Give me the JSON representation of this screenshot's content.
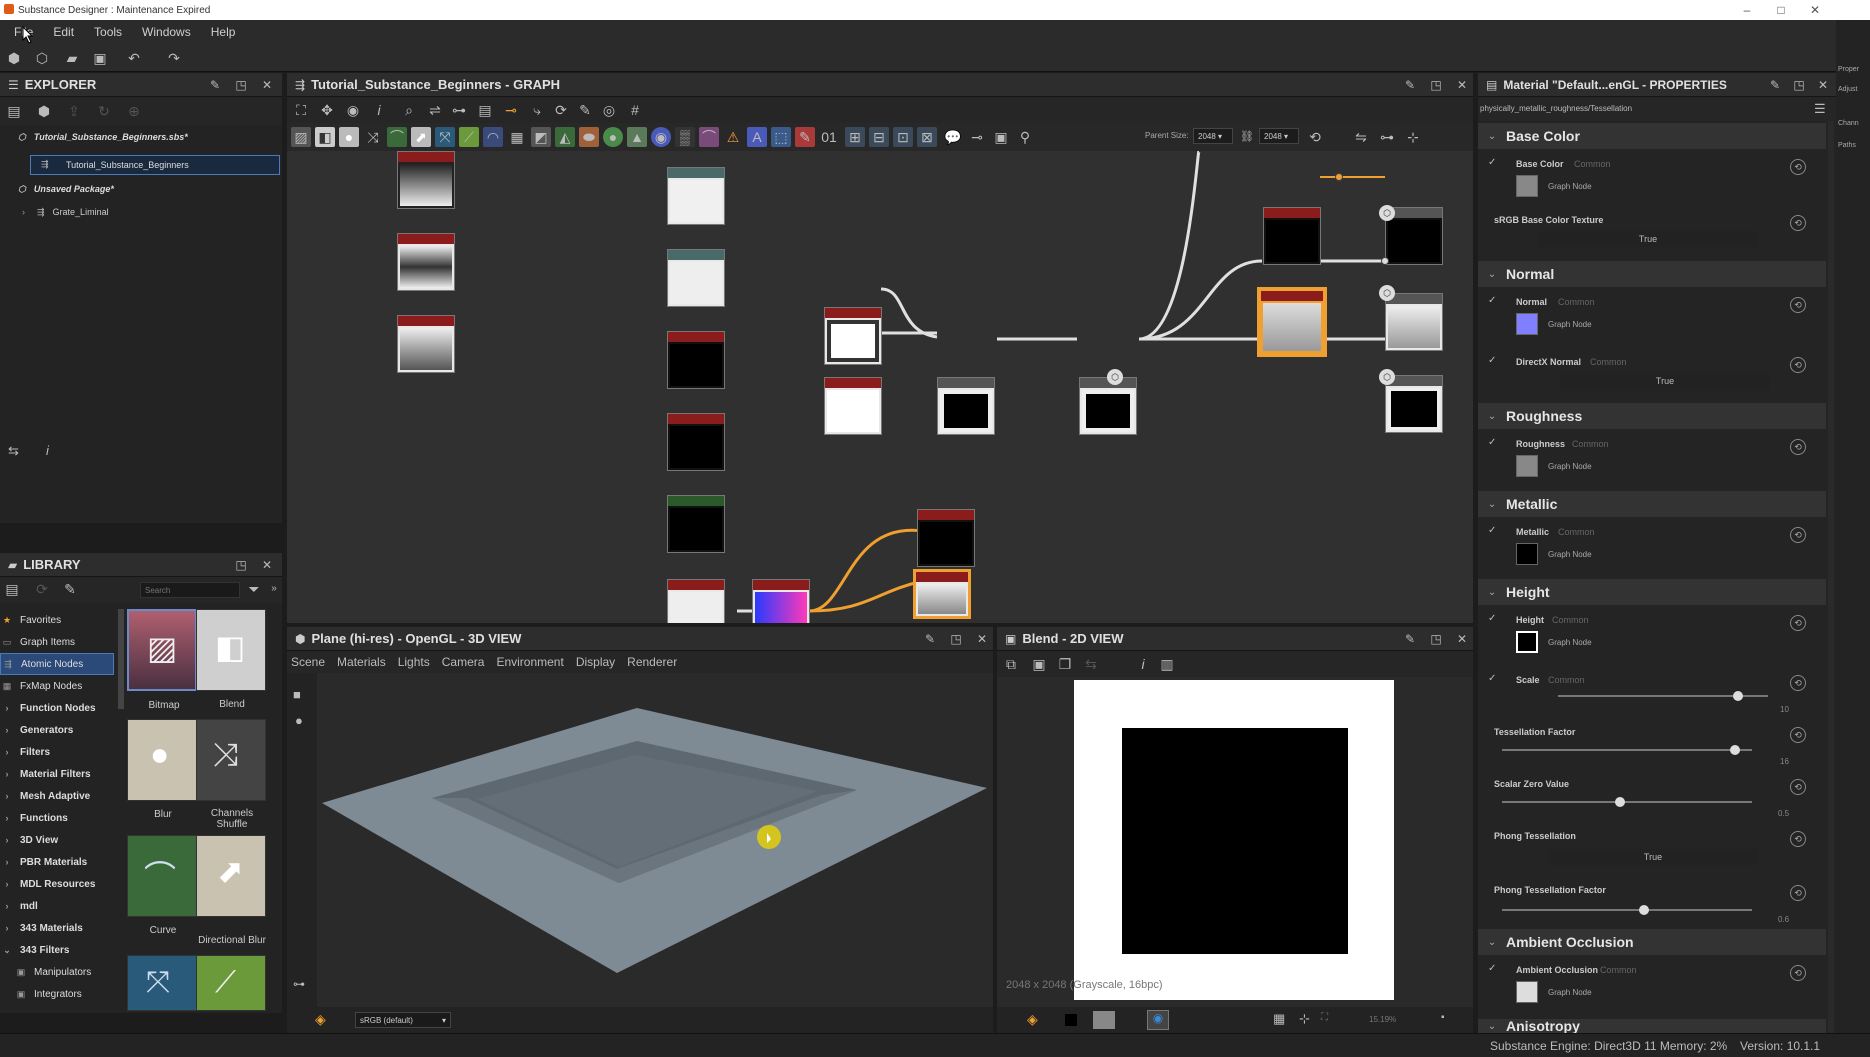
{
  "window": {
    "title": "Substance Designer : Maintenance Expired",
    "minimize": "–",
    "maximize": "□",
    "close": "✕"
  },
  "menu": [
    "File",
    "Edit",
    "Tools",
    "Windows",
    "Help"
  ],
  "explorer": {
    "title": "EXPLORER",
    "items": [
      {
        "label": "Tutorial_Substance_Beginners.sbs*"
      },
      {
        "label": "Tutorial_Substance_Beginners"
      },
      {
        "label": "Unsaved Package*"
      },
      {
        "label": "Grate_Liminal"
      }
    ]
  },
  "library": {
    "title": "LIBRARY",
    "search_placeholder": "Search",
    "categories": [
      "Favorites",
      "Graph Items",
      "Atomic Nodes",
      "FxMap Nodes",
      "Function Nodes",
      "Generators",
      "Filters",
      "Material Filters",
      "Mesh Adaptive",
      "Functions",
      "3D View",
      "PBR Materials",
      "MDL Resources",
      "mdl",
      "343 Materials",
      "343 Filters",
      "Manipulators",
      "Integrators"
    ],
    "thumbs": [
      "Bitmap",
      "Blend",
      "Blur",
      "Channels Shuffle",
      "Curve",
      "Directional Blur"
    ]
  },
  "graph": {
    "title": "Tutorial_Substance_Beginners - GRAPH",
    "parent_size_label": "Parent Size:",
    "parent_size_value": "2048",
    "size_value": "2048"
  },
  "view3d": {
    "title": "Plane (hi-res) - OpenGL - 3D VIEW",
    "menu": [
      "Scene",
      "Materials",
      "Lights",
      "Camera",
      "Environment",
      "Display",
      "Renderer"
    ],
    "colorspace": "sRGB (default)"
  },
  "view2d": {
    "title": "Blend - 2D VIEW",
    "info": "2048 x 2048 (Grayscale, 16bpc)",
    "zoom": "15.19%"
  },
  "properties": {
    "title": "Material \"Default...enGL - PROPERTIES",
    "path": "physically_metallic_roughness/Tessellation",
    "sections": {
      "base_color": "Base Color",
      "normal": "Normal",
      "roughness": "Roughness",
      "metallic": "Metallic",
      "height": "Height",
      "ao": "Ambient Occlusion",
      "anisotropy": "Anisotropy"
    },
    "rows": {
      "base_color": "Base Color",
      "common": "Common",
      "graph_node": "Graph Node",
      "srgb": "sRGB Base Color Texture",
      "true": "True",
      "normal": "Normal",
      "directx": "DirectX Normal",
      "roughness": "Roughness",
      "metallic": "Metallic",
      "height": "Height",
      "scale": "Scale",
      "scale_value": "10",
      "tess": "Tessellation Factor",
      "tess_value": "16",
      "scalar_zero": "Scalar Zero Value",
      "scalar_zero_value": "0.5",
      "phong": "Phong Tessellation",
      "phong_factor": "Phong Tessellation Factor",
      "phong_factor_value": "0.6",
      "ao": "Ambient Occlusion"
    }
  },
  "right_strip": [
    "Proper",
    "Adjust",
    "Chann",
    "Paths"
  ],
  "status": {
    "engine": "Substance Engine: Direct3D 11  Memory: 2%",
    "version": "Version: 10.1.1"
  },
  "colors": {
    "accent": "#f0a030",
    "selection": "#2b4a7a",
    "normal_swatch": "#7f7fff"
  }
}
